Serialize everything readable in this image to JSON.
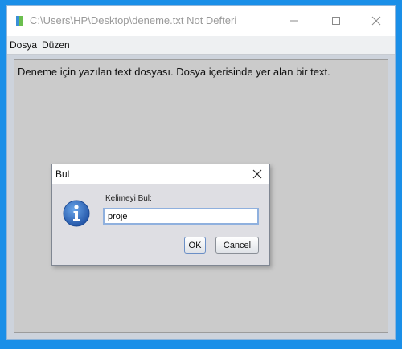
{
  "window": {
    "title": "C:\\Users\\HP\\Desktop\\deneme.txt Not Defteri",
    "controls": [
      "minimize-icon",
      "maximize-icon",
      "close-icon"
    ]
  },
  "menu": {
    "items": [
      {
        "label": "Dosya"
      },
      {
        "label": "Düzen"
      }
    ]
  },
  "editor": {
    "content": "Deneme için yazılan text dosyası. Dosya içerisinde yer alan bir text."
  },
  "dialog": {
    "title": "Bul",
    "icon": "info-icon",
    "label": "Kelimeyi Bul:",
    "input_value": "proje",
    "ok_label": "OK",
    "cancel_label": "Cancel"
  },
  "colors": {
    "desktop": "#1a8fe8",
    "window_body": "#cdd3dc",
    "editor_bg": "#cbcbcb",
    "input_border": "#8fb0de",
    "info_icon": "#2f6fc4"
  }
}
